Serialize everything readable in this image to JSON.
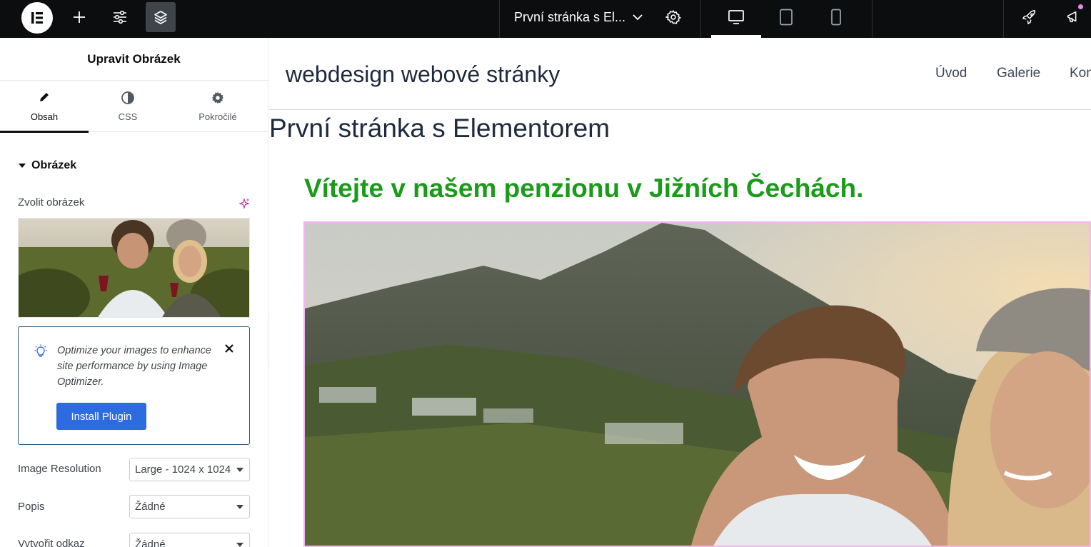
{
  "topbar": {
    "page_title": "První stránka s El...",
    "icons": [
      "elementor-logo-icon",
      "add-icon",
      "settings-sliders-icon",
      "layers-icon",
      "page-settings-icon",
      "desktop-icon",
      "tablet-icon",
      "mobile-icon",
      "rocket-icon",
      "megaphone-icon"
    ],
    "accent": "#0c0d0e"
  },
  "panel": {
    "title": "Upravit Obrázek",
    "tabs": [
      {
        "label": "Obsah",
        "icon": "pencil-icon"
      },
      {
        "label": "CSS",
        "icon": "contrast-icon"
      },
      {
        "label": "Pokročilé",
        "icon": "gear-icon"
      }
    ],
    "section_title": "Obrázek",
    "choose_image_label": "Zvolit obrázek",
    "notice": {
      "text": "Optimize your images to enhance site performance by using Image Optimizer.",
      "button": "Install Plugin",
      "button_color": "#2f6be0"
    },
    "fields": [
      {
        "label": "Image Resolution",
        "value": "Large - 1024 x 1024"
      },
      {
        "label": "Popis",
        "value": "Žádné"
      },
      {
        "label": "Vytvořit odkaz",
        "value": "Žádné"
      }
    ]
  },
  "preview": {
    "site_title": "webdesign webové stránky",
    "nav": [
      "Úvod",
      "Galerie",
      "Kontakt"
    ],
    "page_heading": "První stránka s Elementorem",
    "welcome_heading": "Vítejte v našem penzionu v Jižních Čechách.",
    "welcome_color": "#1b9a1b"
  }
}
